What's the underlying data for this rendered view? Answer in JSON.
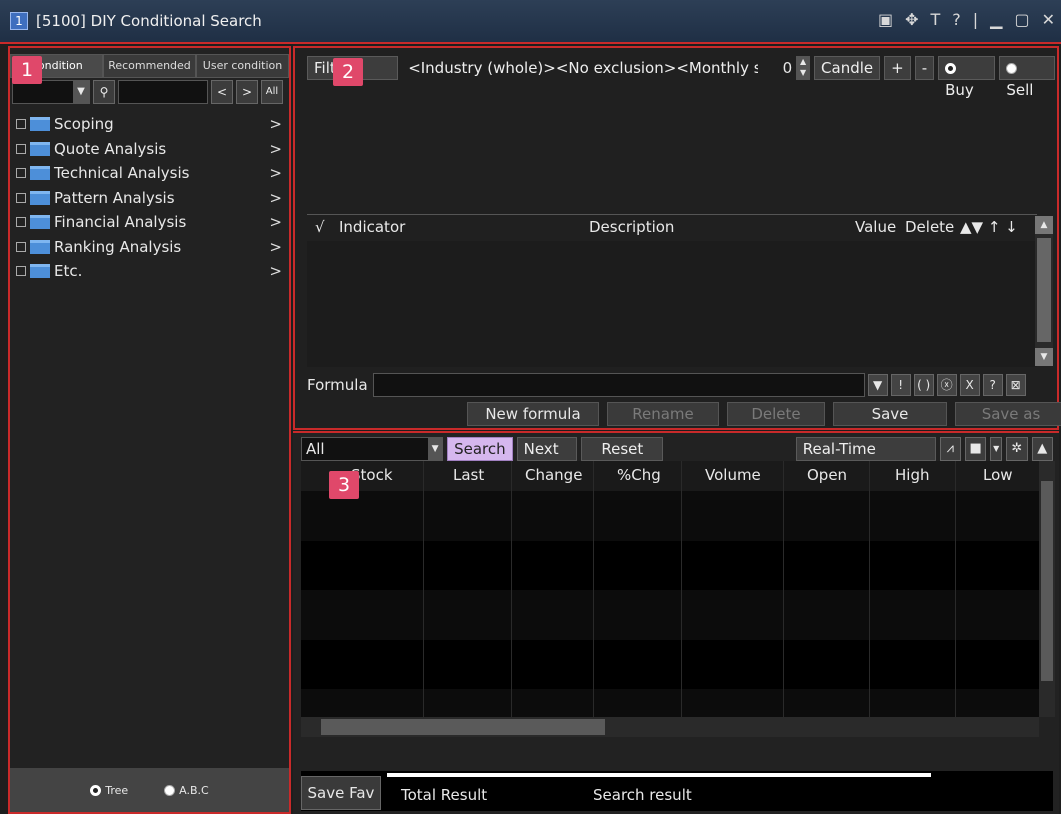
{
  "window": {
    "number": "1",
    "title": "[5100] DIY Conditional Search",
    "controls": [
      "▣",
      "✥",
      "T",
      "?",
      "|",
      "▁",
      "▢",
      "✕"
    ]
  },
  "left_panel": {
    "tabs": [
      "Condition",
      "Recommended",
      "User condition"
    ],
    "tree": [
      {
        "label": "Scoping"
      },
      {
        "label": "Quote Analysis"
      },
      {
        "label": "Technical Analysis"
      },
      {
        "label": "Pattern Analysis"
      },
      {
        "label": "Financial Analysis"
      },
      {
        "label": "Ranking Analysis"
      },
      {
        "label": "Etc."
      }
    ],
    "chevron": ">",
    "nav": {
      "prev": "<",
      "next": ">",
      "all": "All"
    },
    "footer": {
      "tree": "Tree",
      "abc": "A.B.C"
    }
  },
  "condition_panel": {
    "filter_btn": "Filter",
    "filter_text": "<Industry (whole)><No exclusion><Monthly s",
    "count": "0",
    "candle": "Candle",
    "plus": "+",
    "minus": "-",
    "buy": "Buy",
    "sell": "Sell",
    "indicator_headers": {
      "check": "√",
      "indicator": "Indicator",
      "description": "Description",
      "value": "Value",
      "delete": "Delete",
      "arrows": "▲▼ ↑ ↓"
    },
    "formula_label": "Formula",
    "formula_buttons": [
      "▼",
      "!",
      "( )",
      "ⓧ",
      "X",
      "?",
      "⊠"
    ],
    "actions": {
      "new_formula": "New formula",
      "rename": "Rename",
      "delete": "Delete",
      "save": "Save",
      "save_as": "Save as"
    }
  },
  "results_panel": {
    "scope": "All",
    "search": "Search",
    "next": "Next",
    "reset": "Reset",
    "realtime": "Real-Time Search",
    "columns": [
      "Stock",
      "Last",
      "Change",
      "%Chg",
      "Volume",
      "Open",
      "High",
      "Low"
    ],
    "save_fav": "Save Fav",
    "total_result": "Total Result",
    "search_result": "Search result"
  },
  "badges": [
    "1",
    "2",
    "3"
  ]
}
